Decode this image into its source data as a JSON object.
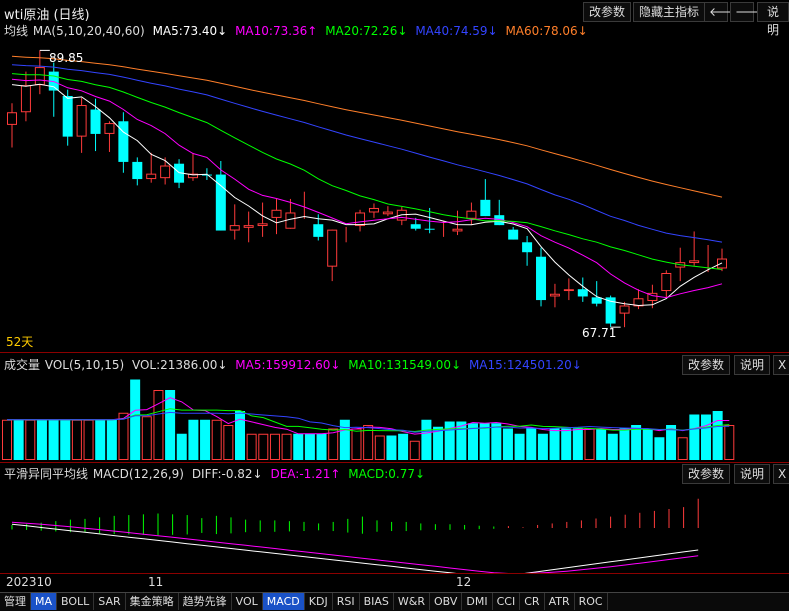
{
  "header": {
    "title": "wti原油 (日线)",
    "buttons": [
      "改参数",
      "隐藏主指标",
      "说明"
    ],
    "nav_left_icon": "arrow-left-icon",
    "nav_right_icon": "arrow-right-icon"
  },
  "ma_panel": {
    "label": "均线",
    "params": "MA(5,10,20,40,60)",
    "ma5": "MA5:73.40↓",
    "ma10": "MA10:73.36↑",
    "ma20": "MA20:72.26↓",
    "ma40": "MA40:74.59↓",
    "ma60": "MA60:78.06↓",
    "high_label": "89.85",
    "low_label": "67.71",
    "period": "52天"
  },
  "vol_panel": {
    "label": "成交量",
    "params": "VOL(5,10,15)",
    "vol": "VOL:21386.00↓",
    "ma5": "MA5:159912.60↓",
    "ma10": "MA10:131549.00↓",
    "ma15": "MA15:124501.20↓",
    "buttons": [
      "改参数",
      "说明",
      "X"
    ]
  },
  "macd_panel": {
    "label": "平滑异同平均线",
    "params": "MACD(12,26,9)",
    "diff": "DIFF:-0.82↓",
    "dea": "DEA:-1.21↑",
    "macd": "MACD:0.77↓",
    "buttons": [
      "改参数",
      "说明",
      "X"
    ]
  },
  "x_axis": {
    "start": "202310",
    "month11": "11",
    "month12": "12"
  },
  "tabs": [
    "管理",
    "MA",
    "BOLL",
    "SAR",
    "集金策略",
    "趋势先锋",
    "VOL",
    "MACD",
    "KDJ",
    "RSI",
    "BIAS",
    "W&R",
    "OBV",
    "DMI",
    "CCI",
    "CR",
    "ATR",
    "ROC"
  ],
  "active_tabs": [
    "MA",
    "MACD"
  ],
  "colors": {
    "up": "#ff3b3b",
    "down": "#00ffff",
    "ma5": "#ffffff",
    "ma10": "#ff00ff",
    "ma20": "#00ff00",
    "ma40": "#3344ff",
    "ma60": "#ff7f2a",
    "header_red": "#8b0000"
  },
  "chart_data": [
    {
      "type": "candlestick",
      "title": "wti原油 (日线)",
      "ohlc": [
        [
          81.6,
          84.0,
          79.1,
          83.0
        ],
        [
          83.0,
          87.5,
          82.0,
          86.0
        ],
        [
          86.0,
          89.85,
          85.0,
          88.0
        ],
        [
          87.5,
          88.5,
          82.5,
          85.4
        ],
        [
          84.8,
          85.5,
          79.3,
          80.3
        ],
        [
          80.3,
          84.6,
          78.5,
          83.8
        ],
        [
          83.3,
          84.5,
          78.7,
          80.6
        ],
        [
          80.6,
          82.0,
          78.6,
          81.8
        ],
        [
          82.0,
          83.0,
          76.3,
          77.5
        ],
        [
          77.5,
          78.0,
          74.9,
          75.6
        ],
        [
          75.6,
          78.5,
          75.2,
          76.2
        ],
        [
          75.7,
          78.0,
          75.0,
          77.1
        ],
        [
          77.3,
          77.8,
          74.6,
          75.2
        ],
        [
          75.7,
          78.5,
          75.4,
          76.2
        ],
        [
          76.1,
          76.8,
          75.5,
          76.0
        ],
        [
          76.1,
          77.6,
          69.9,
          69.9
        ],
        [
          69.9,
          72.8,
          68.9,
          70.5
        ],
        [
          70.2,
          72.0,
          68.6,
          70.5
        ],
        [
          70.4,
          73.0,
          69.2,
          70.7
        ],
        [
          71.3,
          73.4,
          69.5,
          72.2
        ],
        [
          70.1,
          73.4,
          70.1,
          71.9
        ],
        [
          71.9,
          74.2,
          71.2,
          72.0
        ],
        [
          70.6,
          71.7,
          68.8,
          69.2
        ],
        [
          65.9,
          70.0,
          64.3,
          70.0
        ],
        [
          69.7,
          70.3,
          68.6,
          69.7
        ],
        [
          70.4,
          72.2,
          69.8,
          71.9
        ],
        [
          71.9,
          72.9,
          71.3,
          72.4
        ],
        [
          71.7,
          72.6,
          71.5,
          72.0
        ],
        [
          71.0,
          72.5,
          70.5,
          72.2
        ],
        [
          70.6,
          71.3,
          69.9,
          70.1
        ],
        [
          70.1,
          72.4,
          69.6,
          70.0
        ],
        [
          70.3,
          70.9,
          69.2,
          70.4
        ],
        [
          69.8,
          72.1,
          69.4,
          70.1
        ],
        [
          71.2,
          73.0,
          70.5,
          72.1
        ],
        [
          73.3,
          75.6,
          71.5,
          71.5
        ],
        [
          71.6,
          73.3,
          70.5,
          70.5
        ],
        [
          70.0,
          70.3,
          68.9,
          68.9
        ],
        [
          68.6,
          69.3,
          66.0,
          67.5
        ],
        [
          67.0,
          68.0,
          61.5,
          62.2
        ],
        [
          62.6,
          64.0,
          61.4,
          62.9
        ],
        [
          63.2,
          64.6,
          62.2,
          63.4
        ],
        [
          63.4,
          64.7,
          62.0,
          62.6
        ],
        [
          62.5,
          64.3,
          61.5,
          61.8
        ],
        [
          62.5,
          62.7,
          59.2,
          59.6
        ],
        [
          60.7,
          62.0,
          59.2,
          61.6
        ],
        [
          61.5,
          63.4,
          61.2,
          62.4
        ],
        [
          62.1,
          63.9,
          61.3,
          63.0
        ],
        [
          63.2,
          65.5,
          62.4,
          65.2
        ],
        [
          65.8,
          68.0,
          64.3,
          66.4
        ],
        [
          66.3,
          69.8,
          66.0,
          66.6
        ],
        [
          66.6,
          68.3,
          65.3,
          66.6
        ],
        [
          65.7,
          67.9,
          65.4,
          66.8
        ]
      ],
      "annotations": [
        "89.85",
        "67.71",
        "52天"
      ]
    },
    {
      "type": "bar",
      "title": "成交量",
      "values": [
        115,
        115,
        115,
        115,
        115,
        115,
        115,
        115,
        115,
        115,
        135,
        230,
        125,
        200,
        200,
        75,
        115,
        115,
        115,
        100,
        140,
        75,
        75,
        75,
        75,
        75,
        75,
        75,
        90,
        115,
        90,
        100,
        70,
        70,
        75,
        55,
        115,
        95,
        110,
        110,
        105,
        105,
        105,
        90,
        75,
        90,
        75,
        90,
        90,
        90,
        90,
        90,
        75,
        90,
        100,
        90,
        65,
        100,
        65,
        130,
        130,
        140,
        100
      ],
      "colors": [
        "up",
        "down",
        "up",
        "down",
        "down",
        "down",
        "up",
        "up",
        "down",
        "down",
        "up",
        "down",
        "up",
        "up",
        "down",
        "down",
        "down",
        "down",
        "up",
        "up",
        "down",
        "up",
        "up",
        "up",
        "up",
        "down",
        "down",
        "down",
        "up",
        "down",
        "up",
        "up",
        "up",
        "down",
        "down",
        "up",
        "down",
        "down",
        "down",
        "down",
        "down",
        "down",
        "down",
        "down",
        "down",
        "down",
        "down",
        "down",
        "down",
        "down",
        "up",
        "down",
        "down",
        "down",
        "down",
        "down",
        "down",
        "down",
        "up",
        "down",
        "down",
        "down",
        "up"
      ]
    },
    {
      "type": "bar",
      "title": "MACD",
      "values": [
        0.2,
        0.25,
        0.35,
        0.45,
        0.55,
        0.6,
        0.7,
        0.8,
        0.85,
        0.9,
        0.95,
        0.9,
        0.85,
        0.65,
        0.8,
        0.7,
        0.55,
        0.5,
        0.5,
        0.45,
        0.4,
        0.3,
        0.4,
        0.6,
        0.75,
        0.5,
        0.4,
        0.4,
        0.3,
        0.25,
        0.25,
        0.2,
        0.15,
        0.1,
        0.05,
        0.02,
        0.08,
        0.12,
        0.16,
        0.2,
        0.25,
        0.3,
        0.35,
        0.4,
        0.45,
        0.5,
        0.55,
        0.77
      ],
      "colors": [
        "down",
        "down",
        "down",
        "down",
        "down",
        "down",
        "down",
        "down",
        "down",
        "down",
        "down",
        "down",
        "down",
        "down",
        "down",
        "down",
        "down",
        "down",
        "down",
        "down",
        "down",
        "down",
        "down",
        "down",
        "down",
        "down",
        "down",
        "down",
        "down",
        "down",
        "down",
        "down",
        "down",
        "down",
        "up",
        "up",
        "up",
        "up",
        "up",
        "up",
        "up",
        "up",
        "up",
        "up",
        "up",
        "up",
        "up",
        "up"
      ]
    }
  ]
}
